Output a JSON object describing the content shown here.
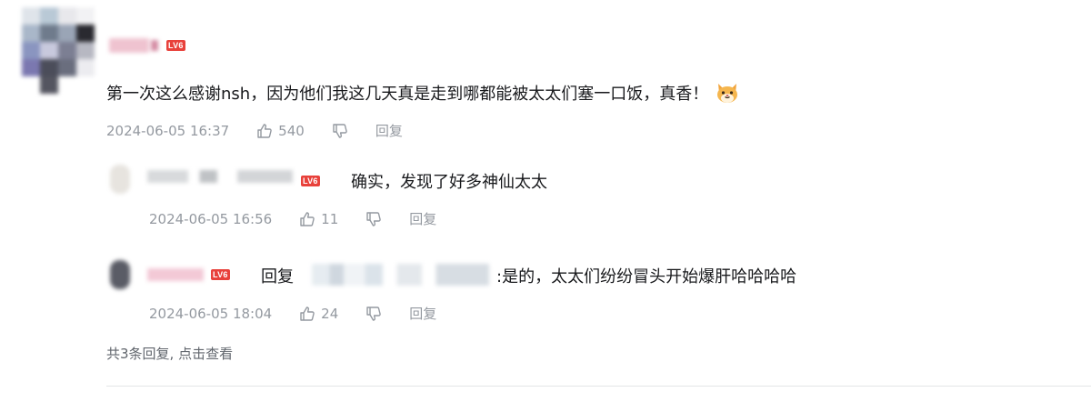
{
  "comment": {
    "level_badge": "LV6",
    "content": "第一次这么感谢nsh，因为他们我这几天真是走到哪都能被太太们塞一口饭，真香！",
    "emoji": "🐱",
    "timestamp": "2024-06-05 16:37",
    "likes": "540",
    "reply_label": "回复"
  },
  "replies": [
    {
      "level_badge": "LV6",
      "content": "确实，发现了好多神仙太太",
      "timestamp": "2024-06-05 16:56",
      "likes": "11",
      "reply_label": "回复"
    },
    {
      "level_badge": "LV6",
      "reply_prefix": "回复",
      "content": ":是的，太太们纷纷冒头开始爆肝哈哈哈哈",
      "timestamp": "2024-06-05 18:04",
      "likes": "24",
      "reply_label": "回复"
    }
  ],
  "more_replies": "共3条回复, 点击查看",
  "icons": [
    "thumb-up-icon",
    "thumb-down-icon",
    "cat-emoji-icon"
  ],
  "colors": {
    "level_badge": "#e8413b",
    "meta_text": "#9499a0",
    "body_text": "#18191c"
  }
}
